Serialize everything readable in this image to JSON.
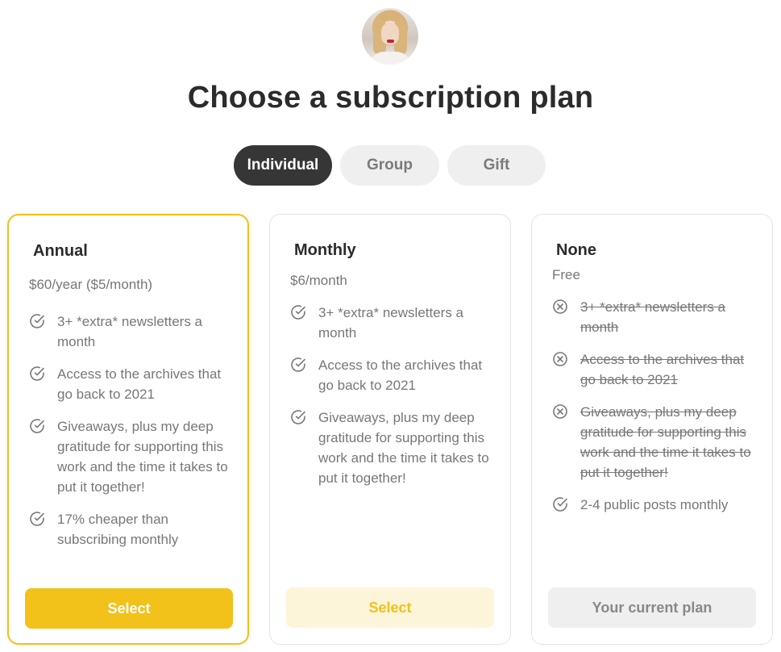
{
  "header": {
    "title": "Choose a subscription plan"
  },
  "tabs": [
    {
      "label": "Individual",
      "active": true
    },
    {
      "label": "Group",
      "active": false
    },
    {
      "label": "Gift",
      "active": false
    }
  ],
  "colors": {
    "accent": "#f2c11a",
    "accent_light": "#fdf5d9",
    "dark_tab": "#363636",
    "muted": "#777777"
  },
  "plans": [
    {
      "name": "Annual",
      "price": "$60/year ($5/month)",
      "features": [
        "3+ *extra* newsletters a month",
        "Access to the archives that go back to 2021",
        "Giveaways, plus my deep gratitude for supporting this work and the time it takes to put it together!",
        "17% cheaper than subscribing monthly"
      ],
      "button_label": "Select"
    },
    {
      "name": "Monthly",
      "price": "$6/month",
      "features": [
        "3+ *extra* newsletters a month",
        "Access to the archives that go back to 2021",
        "Giveaways, plus my deep gratitude for supporting this work and the time it takes to put it together!"
      ],
      "button_label": "Select"
    },
    {
      "name": "None",
      "price": "Free",
      "features": [
        "3+ *extra* newsletters a month",
        "Access to the archives that go back to 2021",
        "Giveaways, plus my deep gratitude for supporting this work and the time it takes to put it together!",
        "2-4 public posts monthly"
      ],
      "button_label": "Your current plan"
    }
  ]
}
